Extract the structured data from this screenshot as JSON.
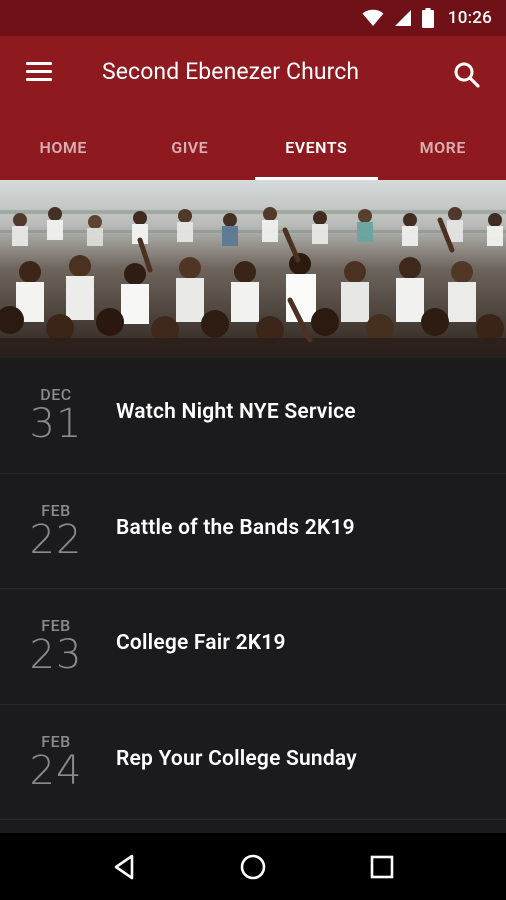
{
  "status_bar": {
    "time": "10:26",
    "icons": [
      "wifi-icon",
      "signal-icon",
      "battery-icon"
    ]
  },
  "app_bar": {
    "title": "Second Ebenezer Church",
    "menu_icon": "hamburger-menu-icon",
    "search_icon": "search-icon"
  },
  "tabs": [
    {
      "label": "HOME",
      "active": false
    },
    {
      "label": "GIVE",
      "active": false
    },
    {
      "label": "EVENTS",
      "active": true
    },
    {
      "label": "MORE",
      "active": false
    }
  ],
  "events": [
    {
      "month": "DEC",
      "day": "31",
      "title": "Watch Night NYE Service"
    },
    {
      "month": "FEB",
      "day": "22",
      "title": "Battle of the Bands 2K19"
    },
    {
      "month": "FEB",
      "day": "23",
      "title": "College Fair 2K19"
    },
    {
      "month": "FEB",
      "day": "24",
      "title": "Rep Your College Sunday"
    }
  ],
  "nav_bar": {
    "icons": [
      "back-icon",
      "home-icon",
      "recents-icon"
    ]
  },
  "colors": {
    "status_bar": "#6f1117",
    "app_bar": "#8e1a1f",
    "list_bg": "#1b1b1d"
  }
}
